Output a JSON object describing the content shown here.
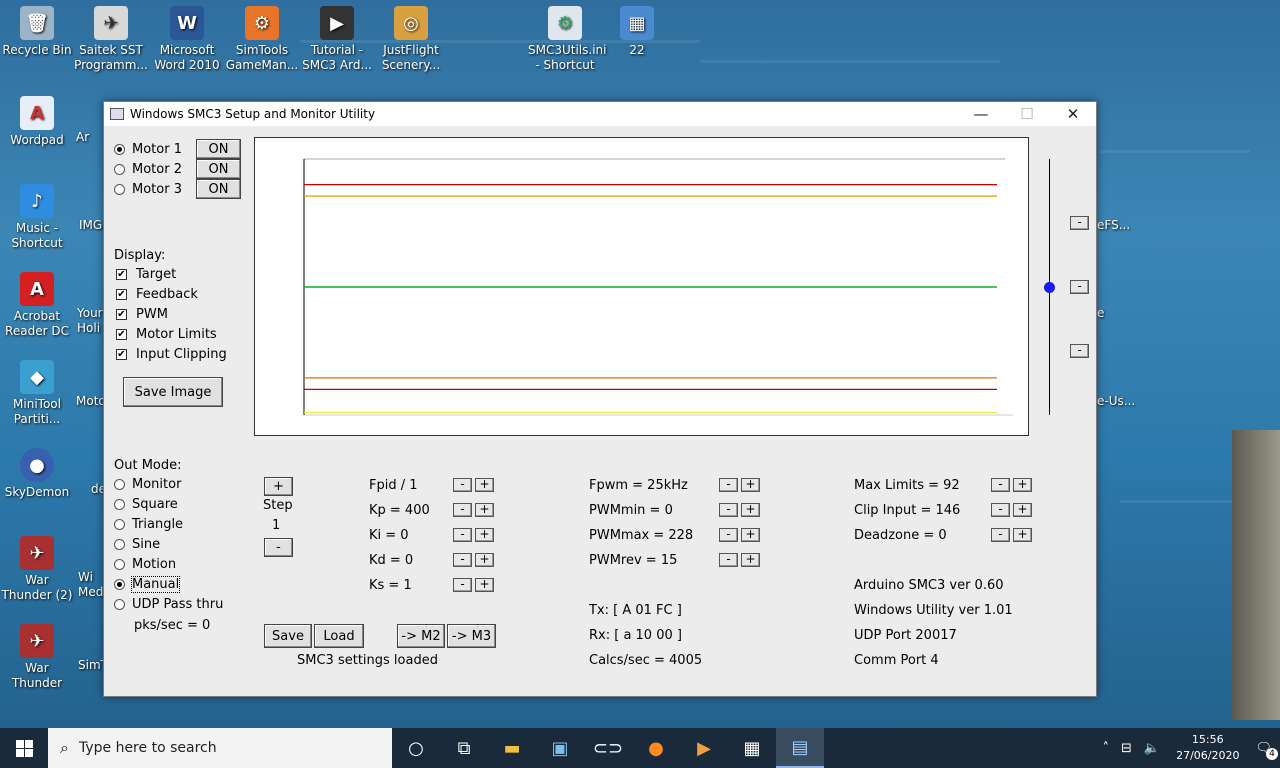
{
  "desktop": {
    "icons": [
      {
        "label": "Recycle Bin",
        "glyph": "🗑",
        "color": "#9bb4c8"
      },
      {
        "label": "Saitek SST Programm...",
        "glyph": "✈",
        "color": "#d8d8d8"
      },
      {
        "label": "Microsoft Word 2010",
        "glyph": "W",
        "color": "#2b5797"
      },
      {
        "label": "SimTools GameMan...",
        "glyph": "⚙",
        "color": "#e8742a"
      },
      {
        "label": "Tutorial - SMC3 Ard...",
        "glyph": "▶",
        "color": "#333333"
      },
      {
        "label": "JustFlight Scenery...",
        "glyph": "◎",
        "color": "#d8a040"
      },
      {
        "label": "SMC3Utils.ini - Shortcut",
        "glyph": "⚙",
        "color": "#dfe6ee"
      },
      {
        "label": "22",
        "glyph": "▦",
        "color": "#4a8ad0"
      },
      {
        "label": "Wordpad",
        "glyph": "A",
        "color": "#e8eef8"
      },
      {
        "label": "Music - Shortcut",
        "glyph": "♪",
        "color": "#2f8de0"
      },
      {
        "label": "Acrobat Reader DC",
        "glyph": "A",
        "color": "#d42020"
      },
      {
        "label": "MiniTool Partiti...",
        "glyph": "◆",
        "color": "#3aa0d0"
      },
      {
        "label": "SkyDemon",
        "glyph": "●",
        "color": "#3860b0"
      },
      {
        "label": "War Thunder (2)",
        "glyph": "✈",
        "color": "#a83030"
      },
      {
        "label": "War Thunder",
        "glyph": "✈",
        "color": "#a83030"
      }
    ],
    "partial_icons": [
      "Ar",
      "IMG",
      "Your Holi",
      "Moto",
      "de",
      "Wi Med",
      "SimT"
    ],
    "right_partial": [
      "eFS...",
      "e",
      "e-Us..."
    ]
  },
  "window": {
    "title": "Windows SMC3 Setup and Monitor Utility",
    "minimize": "—",
    "maximize": "☐",
    "close": "✕"
  },
  "motors": [
    {
      "label": "Motor 1",
      "selected": true,
      "state": "ON"
    },
    {
      "label": "Motor 2",
      "selected": false,
      "state": "ON"
    },
    {
      "label": "Motor 3",
      "selected": false,
      "state": "ON"
    }
  ],
  "display": {
    "heading": "Display:",
    "options": [
      "Target",
      "Feedback",
      "PWM",
      "Motor Limits",
      "Input Clipping"
    ],
    "checkmark": "✔",
    "save_image": "Save Image"
  },
  "out_mode": {
    "heading": "Out Mode:",
    "options": [
      "Monitor",
      "Square",
      "Triangle",
      "Sine",
      "Motion",
      "Manual",
      "UDP Pass thru"
    ],
    "selected": "Manual",
    "pks": "pks/sec = 0"
  },
  "step": {
    "plus": "+",
    "label": "Step",
    "value": "1",
    "minus": "-"
  },
  "pid": [
    "Fpid / 1",
    "Kp = 400",
    "Ki = 0",
    "Kd = 0",
    "Ks = 1"
  ],
  "pwm": [
    "Fpwm = 25kHz",
    "PWMmin = 0",
    "PWMmax = 228",
    "PWMrev = 15"
  ],
  "limits": [
    "Max Limits = 92",
    "Clip Input = 146",
    "Deadzone = 0"
  ],
  "adj": {
    "minus": "-",
    "plus": "+"
  },
  "info": [
    "Arduino SMC3 ver 0.60",
    "Windows Utility ver 1.01",
    "UDP Port 20017",
    "Comm Port 4"
  ],
  "comms": [
    "Tx: [ A 01 FC ]",
    "Rx: [ a 10 00 ]",
    "Calcs/sec = 4005"
  ],
  "buttons": {
    "save": "Save",
    "load": "Load",
    "to_m2": "-> M2",
    "to_m3": "-> M3"
  },
  "status": "SMC3 settings loaded",
  "slider": {
    "minus": "-",
    "value_fraction": 0.5
  },
  "chart_data": {
    "type": "line",
    "title": "",
    "xlabel": "",
    "ylabel": "",
    "ylim": [
      0,
      1
    ],
    "series": [
      {
        "color": "#c80000",
        "values": [
          0.9,
          0.9
        ]
      },
      {
        "color": "#d4a000",
        "values": [
          0.855,
          0.855
        ]
      },
      {
        "color": "#2020c0",
        "values": [
          0.5,
          0.5
        ]
      },
      {
        "color": "#00c000",
        "values": [
          0.5,
          0.5
        ]
      },
      {
        "color": "#e07000",
        "values": [
          0.145,
          0.145
        ]
      },
      {
        "color": "#c80000",
        "values": [
          0.1,
          0.1
        ]
      },
      {
        "color": "#e8e840",
        "values": [
          0.01,
          0.01
        ]
      }
    ]
  },
  "taskbar": {
    "search_placeholder": "Type here to search",
    "time": "15:56",
    "date": "27/06/2020",
    "notifications": "4"
  }
}
